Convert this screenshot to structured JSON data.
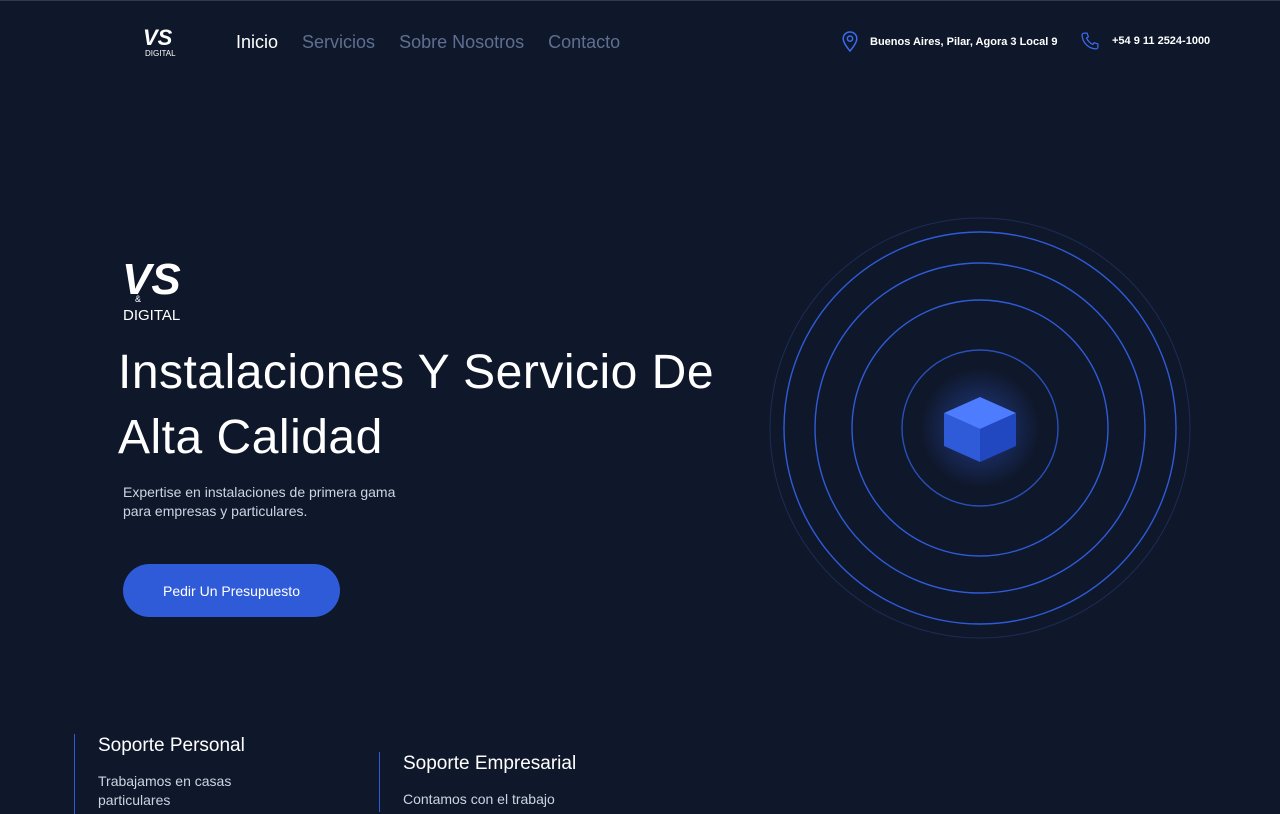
{
  "brand": {
    "logo_text_top": "VS",
    "logo_amp": "&",
    "logo_text_bottom": "DIGITAL"
  },
  "nav": {
    "items": [
      {
        "label": "Inicio"
      },
      {
        "label": "Servicios"
      },
      {
        "label": "Sobre Nosotros"
      },
      {
        "label": "Contacto"
      }
    ]
  },
  "contact": {
    "address": "Buenos Aires, Pilar, Agora 3 Local 9",
    "phone": "+54 9 11 2524-1000",
    "address_icon": "map-pin-icon",
    "phone_icon": "phone-icon"
  },
  "hero": {
    "title": "Instalaciones Y Servicio De Alta Calidad",
    "subtitle": "Expertise en instalaciones de primera gama para empresas y particulares.",
    "cta_label": "Pedir Un Presupuesto",
    "graphic_icon": "cube-icon"
  },
  "services": [
    {
      "title": "Soporte Personal",
      "text": "Trabajamos en casas particulares"
    },
    {
      "title": "Soporte Empresarial",
      "text": "Contamos con el trabajo"
    }
  ],
  "colors": {
    "background": "#0f172a",
    "accent": "#2f5bd8",
    "nav_inactive": "#5e6f8f",
    "text": "#ffffff"
  }
}
